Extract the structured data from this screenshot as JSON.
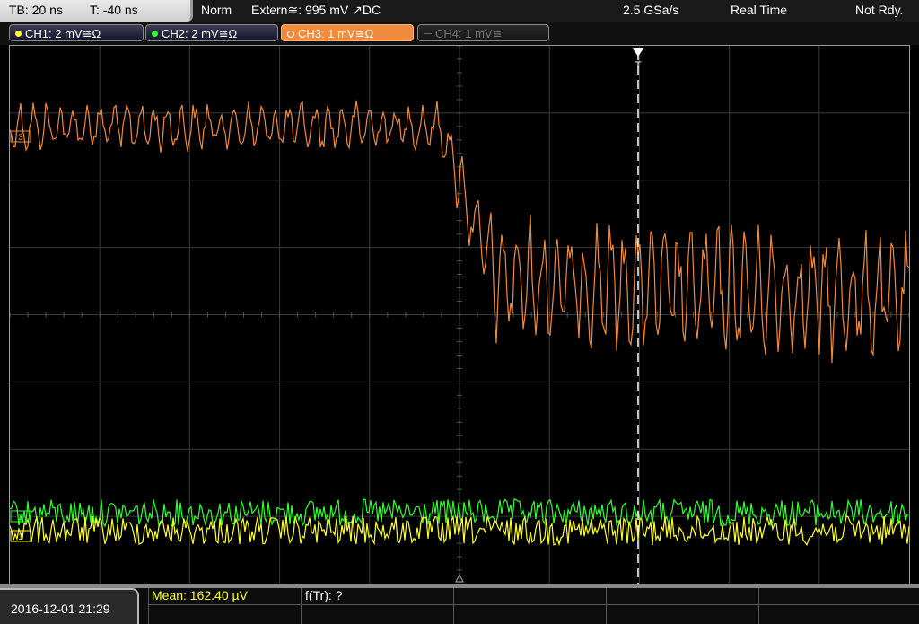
{
  "status": {
    "timebase": "TB: 20 ns",
    "trigger_time": "T: -40 ns",
    "mode": "Norm",
    "trigger": "Extern≅: 995 mV ↗DC",
    "sample_rate": "2.5 GSa/s",
    "acq_mode": "Real Time",
    "state": "Not Rdy."
  },
  "channels": [
    {
      "label": "CH1: 2 mV≅Ω",
      "color": "#ffff33",
      "active": false,
      "enabled": true
    },
    {
      "label": "CH2: 2 mV≅Ω",
      "color": "#33ff33",
      "active": false,
      "enabled": true
    },
    {
      "label": "CH3: 1 mV≅Ω",
      "color": "#f08a3c",
      "active": true,
      "enabled": true
    },
    {
      "label": "CH4: 1 mV≅",
      "color": "#777777",
      "active": false,
      "enabled": false
    }
  ],
  "markers": {
    "ch3": "3",
    "ch2": "2",
    "ch1": "1",
    "trigger": "T"
  },
  "measurements": {
    "mean": "Mean: 162.40 µV",
    "ftr": "f(Tr): ?"
  },
  "datetime": "2016-12-01 21:29",
  "colors": {
    "ch1": "#ffff33",
    "ch2": "#33ff33",
    "ch3": "#f08a3c",
    "grid": "#3a3a3a",
    "cursor": "#ffffff"
  }
}
